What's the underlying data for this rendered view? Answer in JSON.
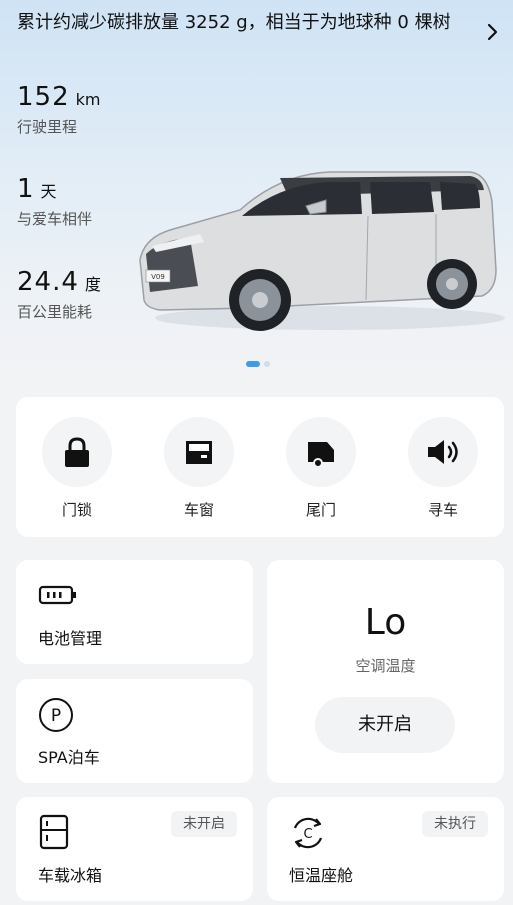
{
  "banner": {
    "text": "累计约减少碳排放量 3252 g，相当于为地球种 0 棵树"
  },
  "stats": {
    "mileage": {
      "value": "152",
      "unit": "km",
      "label": "行驶里程"
    },
    "days": {
      "value": "1",
      "unit": "天",
      "label": "与爱车相伴"
    },
    "energy": {
      "value": "24.4",
      "unit": "度",
      "label": "百公里能耗"
    }
  },
  "car": {
    "plate_text": "V09"
  },
  "quick_actions": [
    {
      "label": "门锁",
      "icon": "lock-icon"
    },
    {
      "label": "车窗",
      "icon": "car-window-icon"
    },
    {
      "label": "尾门",
      "icon": "tailgate-icon"
    },
    {
      "label": "寻车",
      "icon": "speaker-icon"
    }
  ],
  "tiles": {
    "battery": {
      "title": "电池管理",
      "icon": "battery-icon"
    },
    "parking": {
      "title": "SPA泊车",
      "icon": "parking-icon"
    },
    "fridge": {
      "title": "车载冰箱",
      "status": "未开启",
      "icon": "fridge-icon"
    },
    "cabin": {
      "title": "恒温座舱",
      "status": "未执行",
      "icon": "cabin-climate-icon"
    },
    "ac": {
      "value": "Lo",
      "label": "空调温度",
      "button": "未开启"
    }
  },
  "colors": {
    "accent": "#3d9be9",
    "card": "#ffffff",
    "background": "#f2f3f5"
  }
}
